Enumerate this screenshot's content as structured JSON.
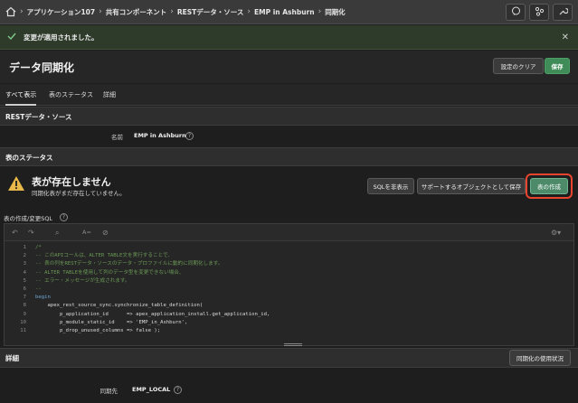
{
  "breadcrumb": {
    "items": [
      "アプリケーション107",
      "共有コンポーネント",
      "RESTデータ・ソース",
      "EMP in Ashburn",
      "同期化"
    ]
  },
  "banner": {
    "message": "変更が適用されました。"
  },
  "header": {
    "title": "データ同期化",
    "clear_label": "設定のクリア",
    "save_label": "保存"
  },
  "tabs": [
    {
      "label": "すべて表示",
      "active": true
    },
    {
      "label": "表のステータス",
      "active": false
    },
    {
      "label": "詳細",
      "active": false
    }
  ],
  "rest_region": {
    "title": "RESTデータ・ソース",
    "name_label": "名前",
    "name_value": "EMP in Ashburn"
  },
  "table_status": {
    "title": "表のステータス",
    "status_title": "表が存在しません",
    "status_sub": "同期化表がまだ存在していません。",
    "hide_sql_label": "SQLを非表示",
    "save_objects_label": "サポートするオブジェクトとして保存",
    "create_table_label": "表の作成",
    "sql_label": "表の作成/変更SQL"
  },
  "code_lines": [
    {
      "n": "1",
      "text": "/*",
      "kind": "comment"
    },
    {
      "n": "2",
      "text": "-- このAPIコールは、ALTER TABLE文を実行することで、",
      "kind": "comment"
    },
    {
      "n": "3",
      "text": "-- 表の列をRESTデータ・ソースのデータ・プロファイルに動的に同期化します。",
      "kind": "comment"
    },
    {
      "n": "4",
      "text": "-- ALTER TABLEを使用して列のデータ型を変更できない場合、",
      "kind": "comment"
    },
    {
      "n": "5",
      "text": "-- エラー・メッセージが生成されます。",
      "kind": "comment"
    },
    {
      "n": "6",
      "text": "--",
      "kind": "comment"
    },
    {
      "n": "7",
      "text": "begin",
      "kind": "kw"
    },
    {
      "n": "8",
      "text": "    apex_rest_source_sync.synchronize_table_definition(",
      "kind": "plain"
    },
    {
      "n": "9",
      "text": "        p_application_id      => apex_application_install.get_application_id,",
      "kind": "plain"
    },
    {
      "n": "10",
      "text": "        p_module_static_id    => 'EMP_in_Ashburn',",
      "kind": "plain"
    },
    {
      "n": "11",
      "text": "        p_drop_unused_columns => false );",
      "kind": "plain"
    }
  ],
  "details_region": {
    "title": "詳細",
    "usage_label": "同期化の使用状況",
    "target_label": "同期先",
    "target_value": "EMP_LOCAL"
  },
  "colors": {
    "primary": "#3f8c58",
    "highlight_ring": "#e8452f",
    "success_banner": "#2e3b2b"
  }
}
